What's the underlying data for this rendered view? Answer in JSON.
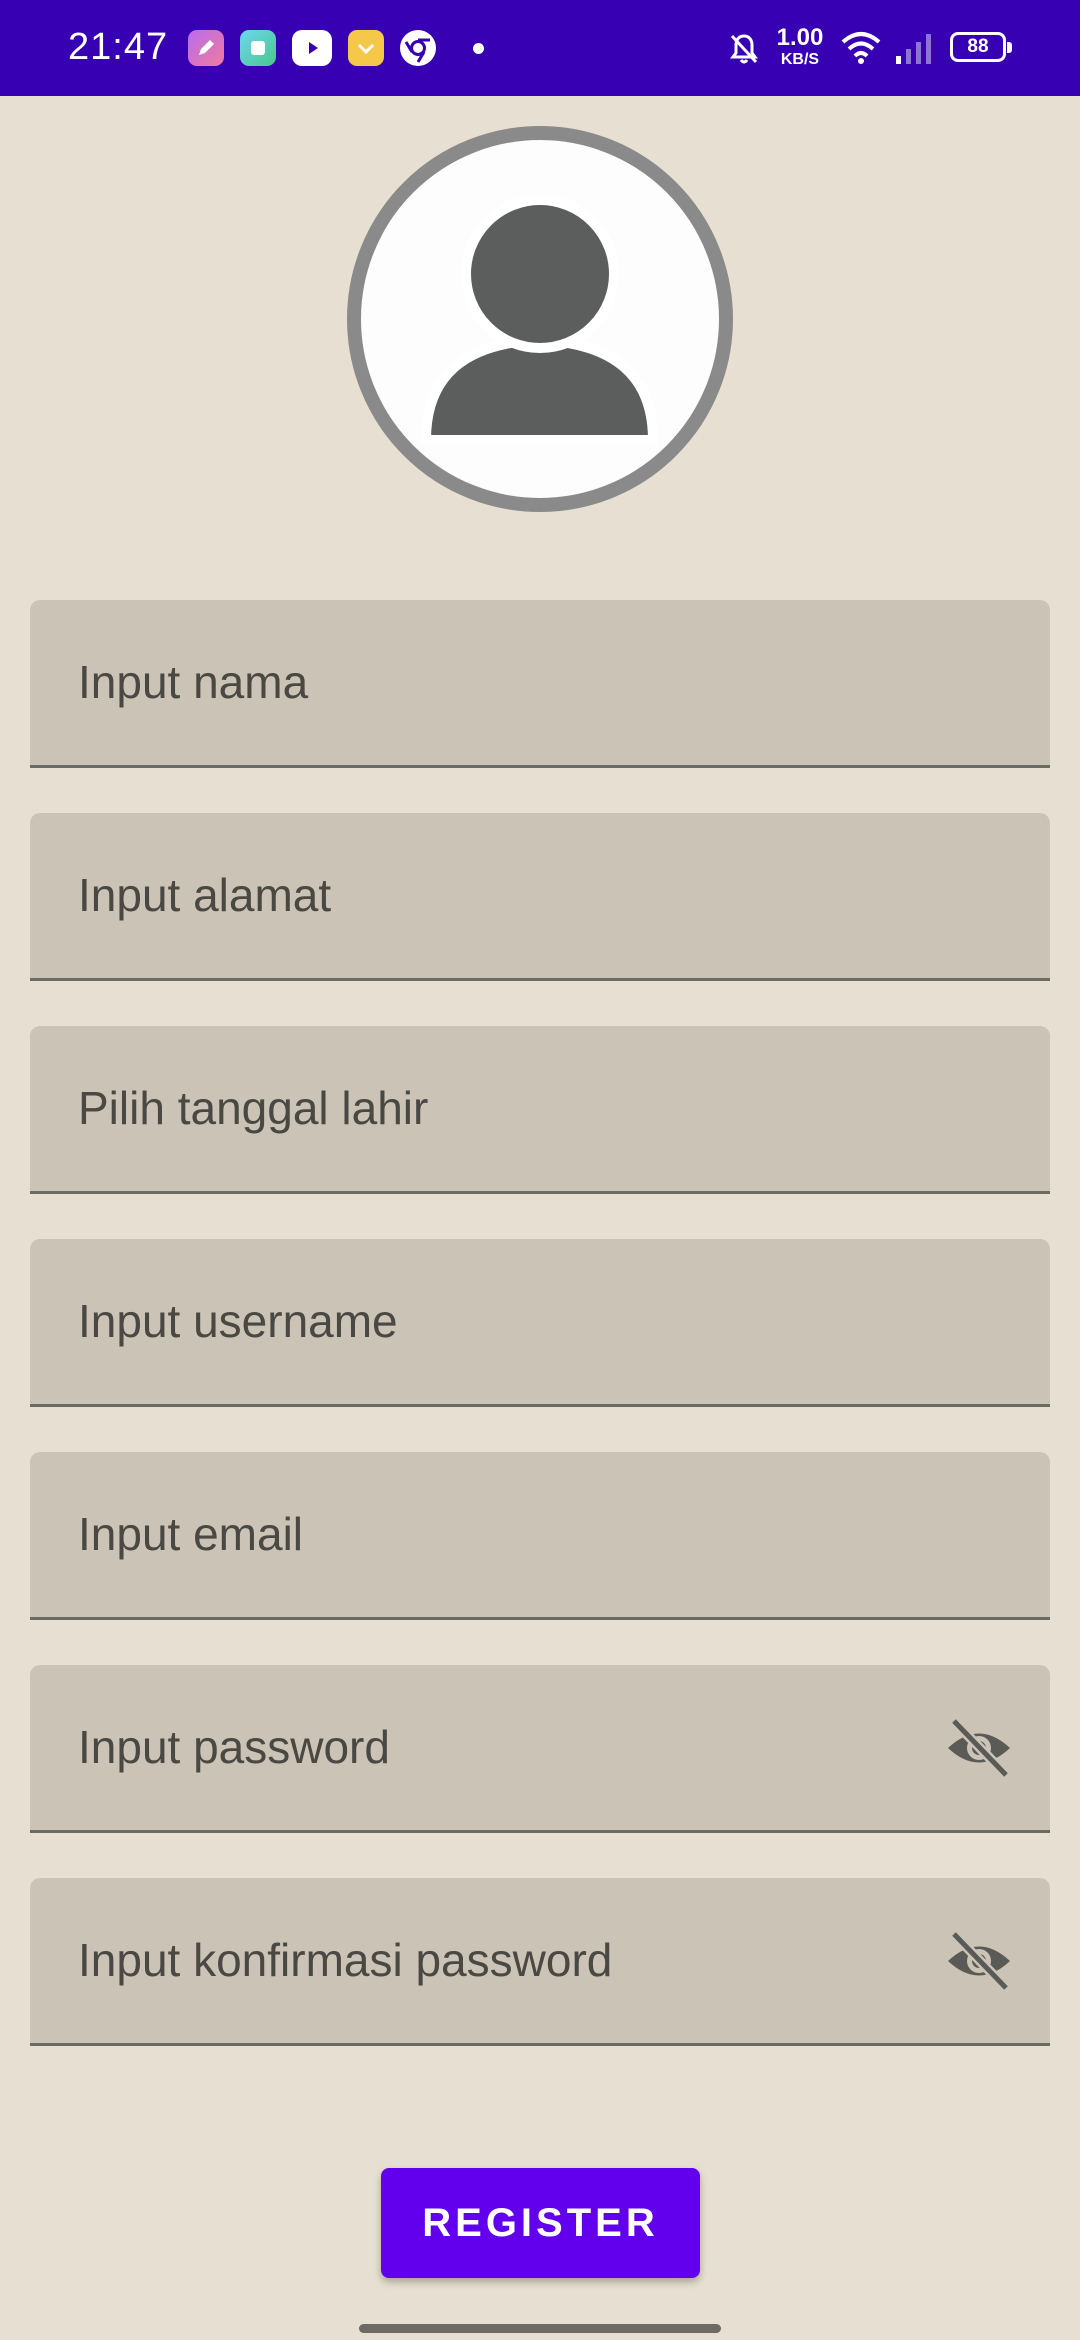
{
  "status_bar": {
    "time": "21:47",
    "network_speed_value": "1.00",
    "network_speed_unit": "KB/S",
    "battery": "88",
    "icons": [
      "edit-app-icon",
      "gallery-app-icon",
      "youtube-icon",
      "wallet-app-icon",
      "chrome-icon",
      "dot-icon",
      "mute-bell-icon",
      "wifi-icon",
      "signal-icon",
      "battery-icon"
    ],
    "background_color": "#3700b3"
  },
  "profile": {
    "avatar_icon": "person-icon"
  },
  "form": {
    "fields": [
      {
        "placeholder": "Input nama"
      },
      {
        "placeholder": "Input alamat"
      },
      {
        "placeholder": "Pilih tanggal lahir"
      },
      {
        "placeholder": "Input username"
      },
      {
        "placeholder": "Input email"
      },
      {
        "placeholder": "Input password",
        "toggle_icon": "eye-off-icon"
      },
      {
        "placeholder": "Input konfirmasi password",
        "toggle_icon": "eye-off-icon"
      }
    ],
    "register_label": "REGISTER",
    "button_color": "#6200ee",
    "field_color": "#cbc4b6",
    "page_background": "#e7e0d2"
  }
}
